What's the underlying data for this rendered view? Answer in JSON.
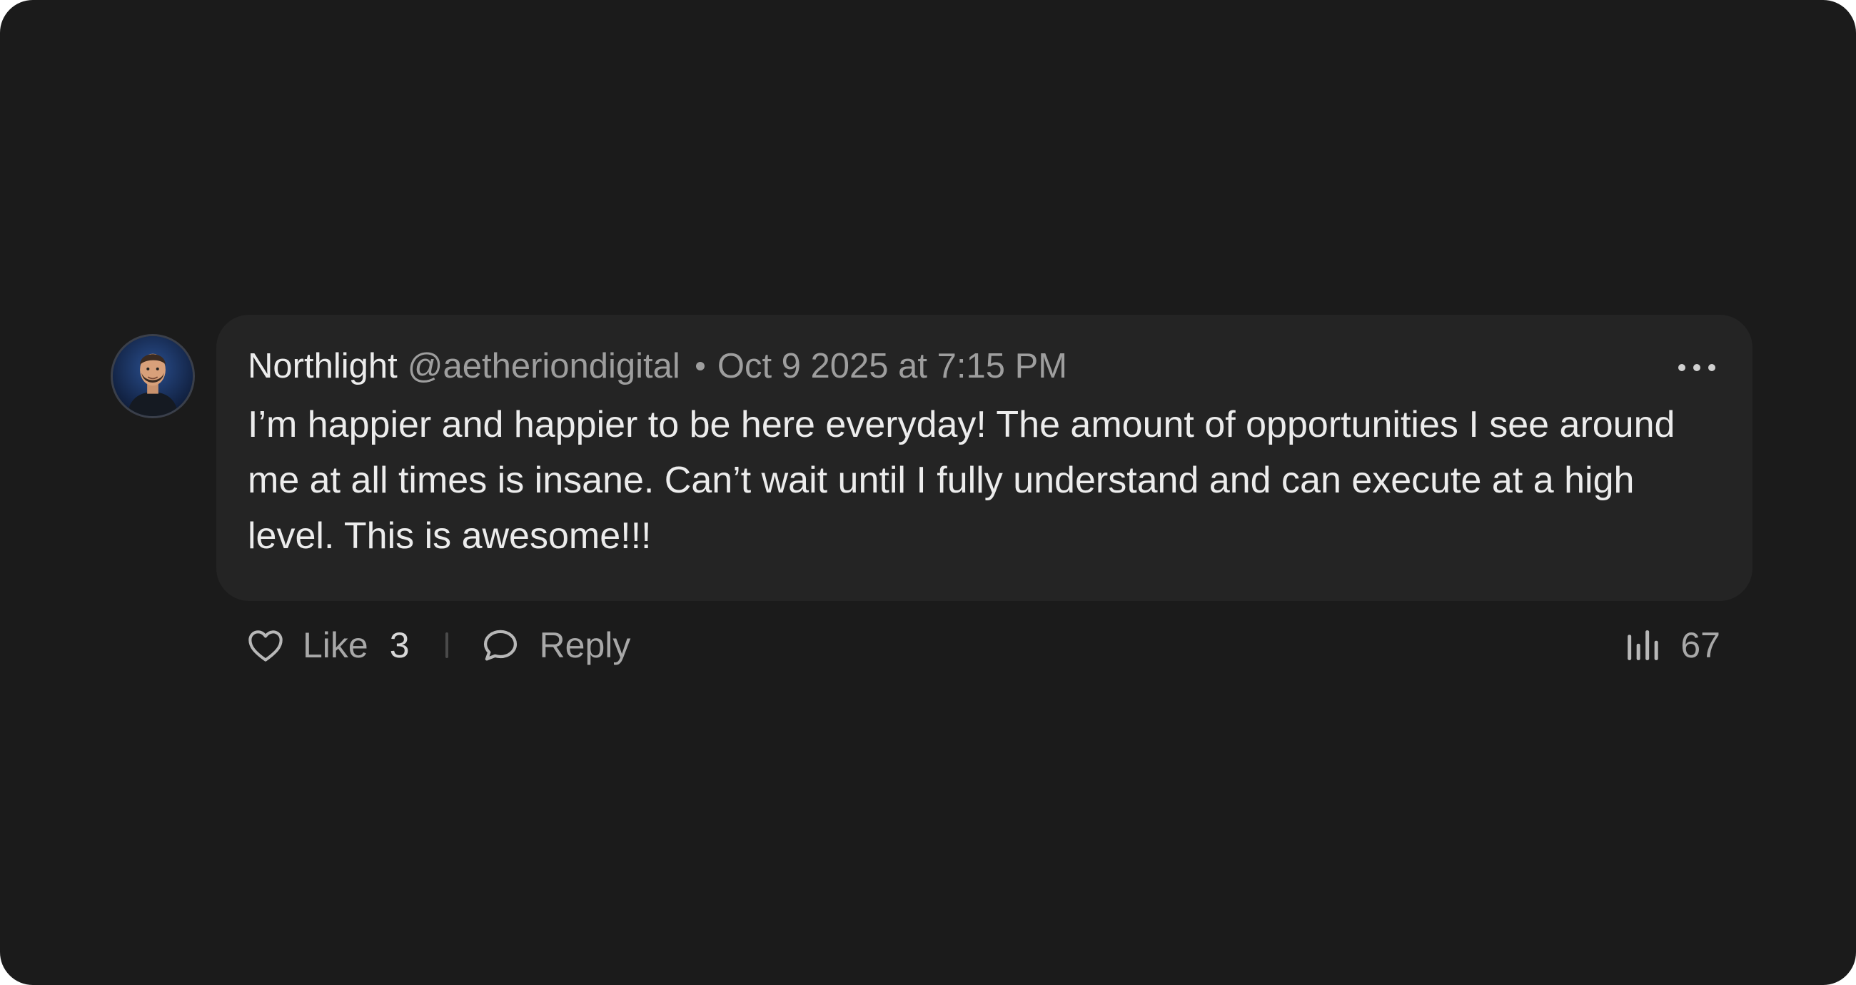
{
  "comment": {
    "author": "Northlight",
    "handle": "@aetheriondigital",
    "timestamp": "Oct 9 2025 at 7:15 PM",
    "text": "I’m happier and happier to be here everyday! The amount of opportunities I see around me at all times is insane. Can’t wait until I fully understand and can execute at a high level. This is awesome!!!",
    "avatar_icon": "user-avatar",
    "more_icon": "more-horizontal-icon"
  },
  "actions": {
    "like_label": "Like",
    "like_count": "3",
    "like_icon": "heart-icon",
    "reply_label": "Reply",
    "reply_icon": "speech-bubble-icon",
    "views_count": "67",
    "views_icon": "bar-chart-icon"
  },
  "colors": {
    "background": "#1b1b1b",
    "card": "#242424",
    "text_primary": "#ececec",
    "text_secondary": "#9e9e9e"
  }
}
